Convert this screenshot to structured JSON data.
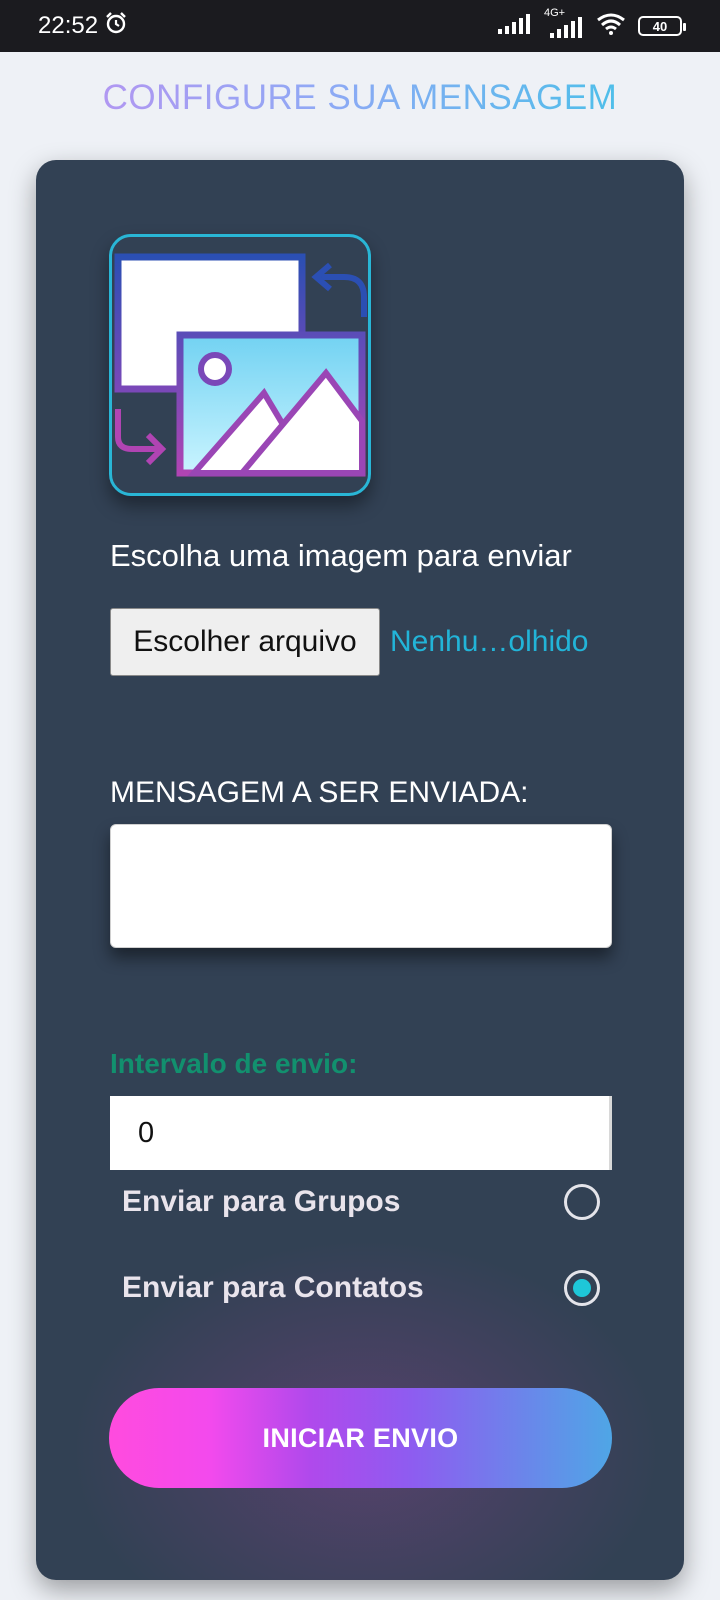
{
  "status_bar": {
    "time": "22:52",
    "network": "4G+",
    "battery": "40"
  },
  "header": {
    "title": "CONFIGURE SUA MENSAGEM"
  },
  "image_section": {
    "label": "Escolha uma imagem para enviar",
    "file_button_label": "Escolher arquivo",
    "file_status": "Nenhu…olhido"
  },
  "message_section": {
    "label": "MENSAGEM A SER ENVIADA:",
    "value": ""
  },
  "interval_section": {
    "label": "Intervalo de envio:",
    "value": "0"
  },
  "send_options": [
    {
      "label": "Enviar para Grupos",
      "checked": false
    },
    {
      "label": "Enviar para Contatos",
      "checked": true
    }
  ],
  "start_button_label": "INICIAR ENVIO",
  "colors": {
    "card_background": "#324154",
    "accent_cyan": "#22b4d8",
    "interval_label": "#12906e",
    "button_gradient_start": "#ff4bde",
    "button_gradient_end": "#4fa6e6"
  }
}
